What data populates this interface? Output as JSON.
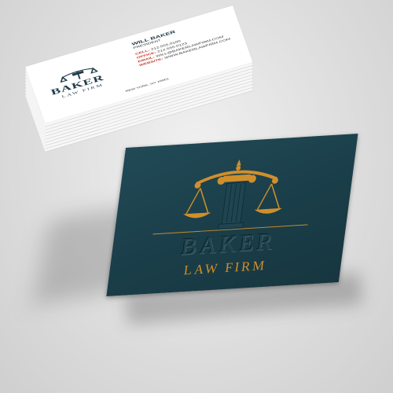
{
  "front_card": {
    "brand": "BAKER",
    "tagline": "LAW FIRM"
  },
  "back_card": {
    "brand": "BAKER",
    "tagline": "LAW FIRM",
    "name": "WILL BAKER",
    "title": "PRESIDENT",
    "lines": [
      {
        "label": "CELL:",
        "value": "212.555.0100"
      },
      {
        "label": "OFFICE:",
        "value": "212.555.0123"
      },
      {
        "label": "EMAIL:",
        "value": "WILL@BAKERLAWFIRM.COM"
      },
      {
        "label": "WEBSITE:",
        "value": "WWW.BAKERLAWFIRM.COM"
      }
    ],
    "address": "NEW YORK, NY 10001"
  },
  "colors": {
    "card_dark": "#1a3e49",
    "gold": "#d08f2c",
    "navy_text": "#1f3b4a",
    "accent_red": "#c0392b"
  },
  "icons": [
    "scales-of-justice-icon",
    "column-icon"
  ]
}
